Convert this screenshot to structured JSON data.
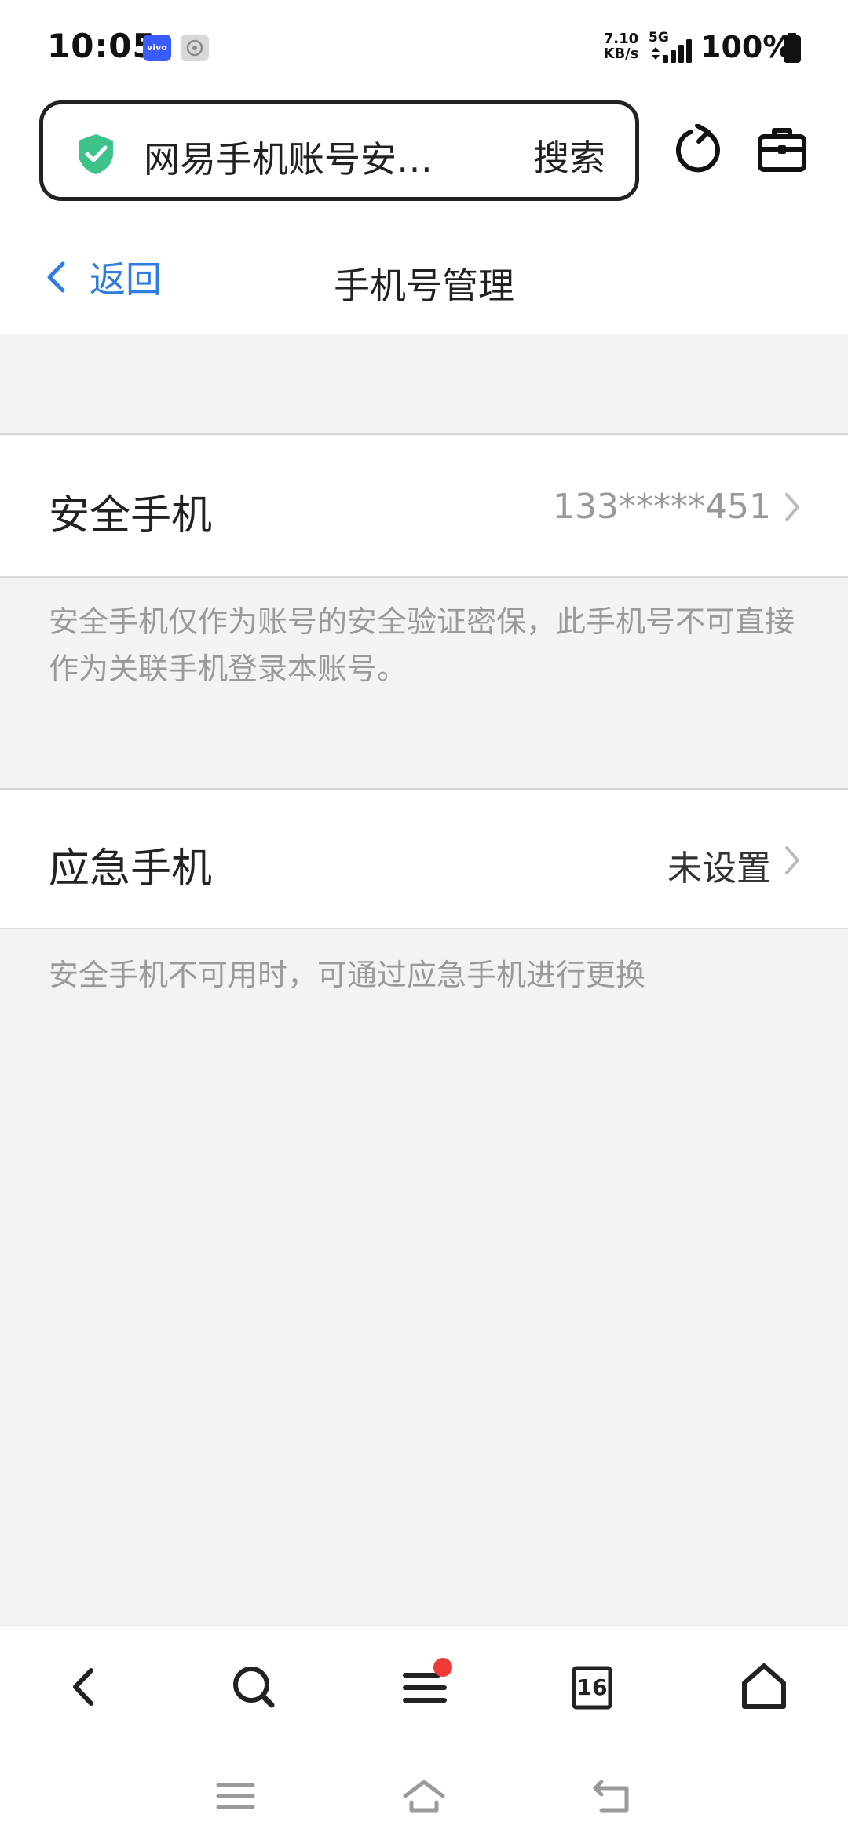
{
  "status_bar": {
    "time": "10:05",
    "vivo_badge": "vivo",
    "net_speed_value": "7.10",
    "net_speed_unit": "KB/s",
    "network_type": "5G",
    "battery": "100%"
  },
  "browser": {
    "url_text": "网易手机账号安…",
    "search_label": "搜索"
  },
  "header": {
    "back_label": "返回",
    "title": "手机号管理"
  },
  "security_phone": {
    "label": "安全手机",
    "value": "133*****451",
    "note": "安全手机仅作为账号的安全验证密保，此手机号不可直接作为关联手机登录本账号。"
  },
  "emergency_phone": {
    "label": "应急手机",
    "value": "未设置",
    "note": "安全手机不可用时，可通过应急手机进行更换"
  },
  "toolbar": {
    "tab_count": "16"
  },
  "colors": {
    "accent_blue": "#2f7de1",
    "shield_green": "#3cc28a",
    "notification_red": "#f03a3a"
  }
}
